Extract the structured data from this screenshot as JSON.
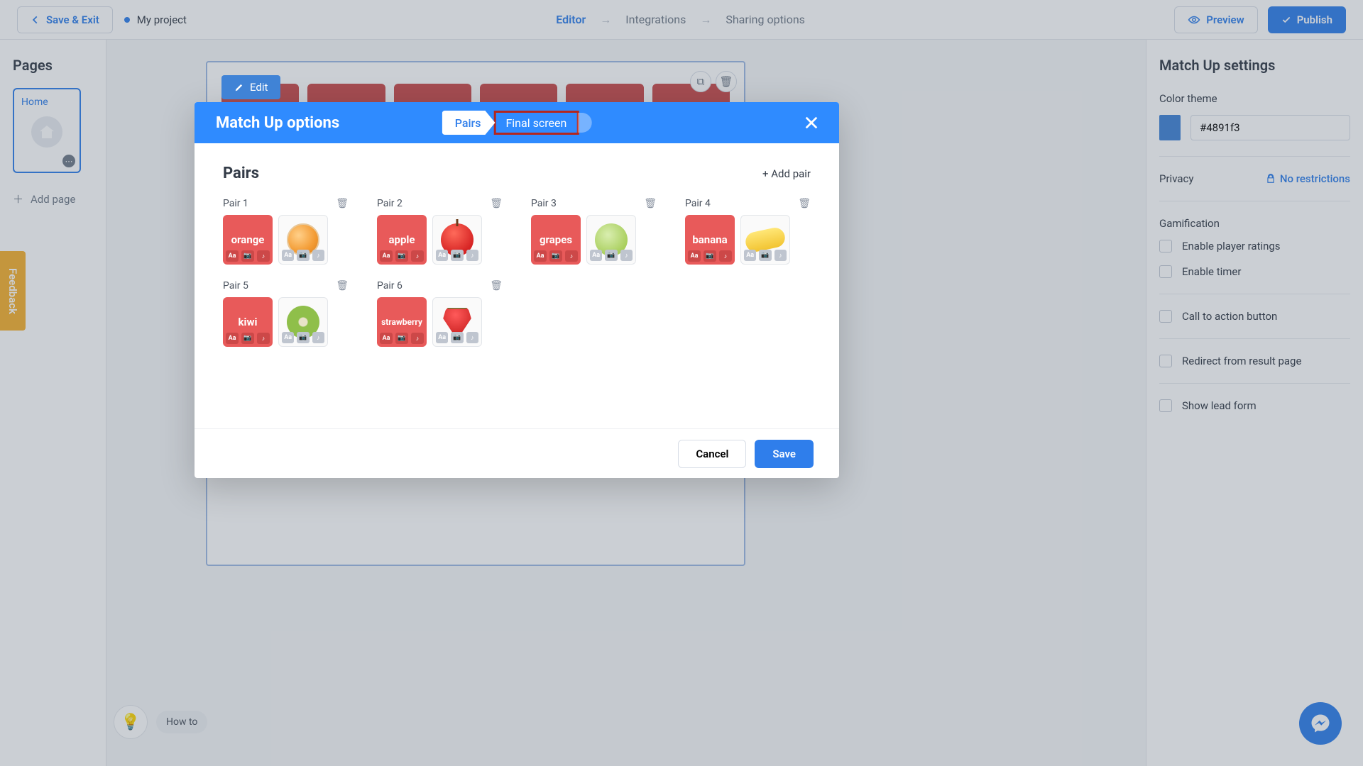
{
  "topbar": {
    "save_exit": "Save & Exit",
    "project_name": "My project",
    "breadcrumbs": {
      "editor": "Editor",
      "integrations": "Integrations",
      "sharing": "Sharing options"
    },
    "preview": "Preview",
    "publish": "Publish"
  },
  "sidebar": {
    "title": "Pages",
    "home": "Home",
    "add_page": "Add page"
  },
  "canvas": {
    "edit": "Edit"
  },
  "howto": {
    "label": "How to"
  },
  "feedback": "Feedback",
  "settings": {
    "title": "Match Up settings",
    "color_theme_label": "Color theme",
    "hex": "#4891f3",
    "privacy_label": "Privacy",
    "privacy_value": "No restrictions",
    "gamification_label": "Gamification",
    "enable_ratings": "Enable player ratings",
    "enable_timer": "Enable timer",
    "cta": "Call to action button",
    "redirect": "Redirect from result page",
    "lead_form": "Show lead form"
  },
  "modal": {
    "title": "Match Up options",
    "tab_pairs": "Pairs",
    "tab_final": "Final screen",
    "section_title": "Pairs",
    "add_pair": "+ Add pair",
    "cancel": "Cancel",
    "save": "Save",
    "pairs": [
      {
        "label": "Pair 1",
        "text": "orange",
        "fruit": "orange-fruit"
      },
      {
        "label": "Pair 2",
        "text": "apple",
        "fruit": "apple-fruit"
      },
      {
        "label": "Pair 3",
        "text": "grapes",
        "fruit": "grapes-fruit"
      },
      {
        "label": "Pair 4",
        "text": "banana",
        "fruit": "banana-fruit"
      },
      {
        "label": "Pair 5",
        "text": "kiwi",
        "fruit": "kiwi-fruit"
      },
      {
        "label": "Pair 6",
        "text": "strawberry",
        "fruit": "strawberry-fruit"
      }
    ],
    "card_tools": {
      "aa": "Aa",
      "cam": "📷",
      "note": "♪"
    }
  }
}
